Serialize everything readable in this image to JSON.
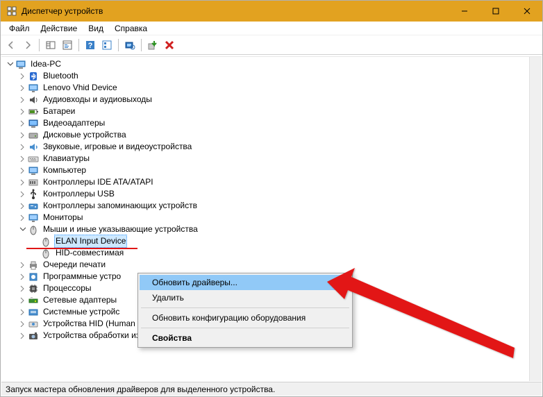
{
  "window": {
    "title": "Диспетчер устройств"
  },
  "menubar": {
    "file": "Файл",
    "action": "Действие",
    "view": "Вид",
    "help": "Справка"
  },
  "tree": {
    "root": "Idea-PC",
    "items": [
      {
        "label": "Bluetooth",
        "icon": "bluetooth"
      },
      {
        "label": "Lenovo Vhid Device",
        "icon": "monitor"
      },
      {
        "label": "Аудиовходы и аудиовыходы",
        "icon": "audio"
      },
      {
        "label": "Батареи",
        "icon": "battery"
      },
      {
        "label": "Видеоадаптеры",
        "icon": "display"
      },
      {
        "label": "Дисковые устройства",
        "icon": "disk"
      },
      {
        "label": "Звуковые, игровые и видеоустройства",
        "icon": "sound"
      },
      {
        "label": "Клавиатуры",
        "icon": "keyboard"
      },
      {
        "label": "Компьютер",
        "icon": "computer"
      },
      {
        "label": "Контроллеры IDE ATA/ATAPI",
        "icon": "ide"
      },
      {
        "label": "Контроллеры USB",
        "icon": "usb"
      },
      {
        "label": "Контроллеры запоминающих устройств",
        "icon": "storage"
      },
      {
        "label": "Мониторы",
        "icon": "monitor"
      },
      {
        "label": "Мыши и иные указывающие устройства",
        "icon": "mouse",
        "expanded": true,
        "children": [
          {
            "label": "ELAN Input Device",
            "icon": "mouse",
            "selected": true
          },
          {
            "label": "HID-совместимая",
            "icon": "mouse"
          }
        ]
      },
      {
        "label": "Очереди печати",
        "icon": "printer"
      },
      {
        "label": "Программные устро",
        "icon": "software"
      },
      {
        "label": "Процессоры",
        "icon": "cpu"
      },
      {
        "label": "Сетевые адаптеры",
        "icon": "network"
      },
      {
        "label": "Системные устройс",
        "icon": "system"
      },
      {
        "label": "Устройства HID (Human Interface Devices)",
        "icon": "hid"
      },
      {
        "label": "Устройства обработки изображений",
        "icon": "imaging"
      }
    ]
  },
  "context_menu": {
    "update": "Обновить драйверы...",
    "delete": "Удалить",
    "refresh": "Обновить конфигурацию оборудования",
    "properties": "Свойства"
  },
  "statusbar": {
    "text": "Запуск мастера обновления драйверов для выделенного устройства."
  }
}
